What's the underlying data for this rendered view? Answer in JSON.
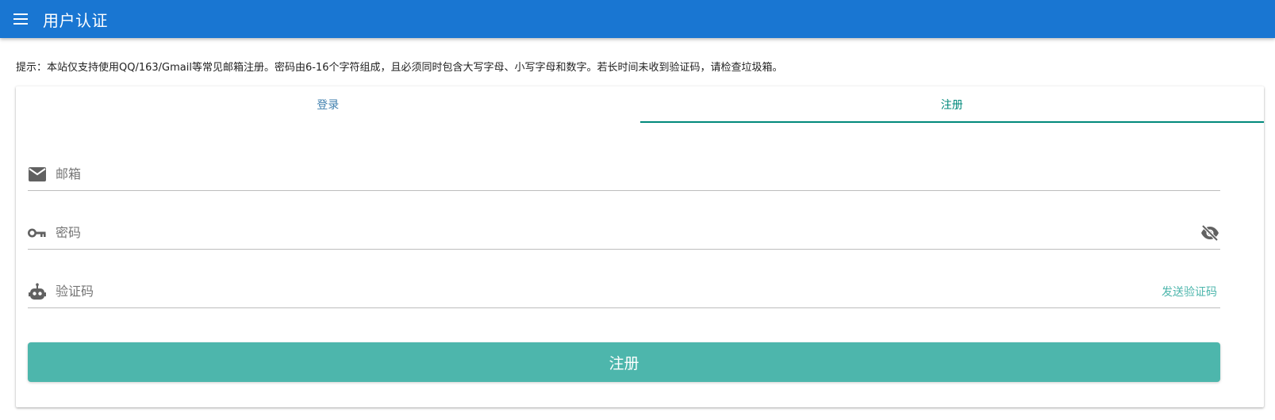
{
  "colors": {
    "primary": "#1976d2",
    "teal": "#00897b",
    "teal_light": "#4db6ac",
    "button": "#4db6ac",
    "icon_gray": "#616161"
  },
  "appbar": {
    "title": "用户认证",
    "menu_icon": "hamburger-menu-icon"
  },
  "notice": "提示：本站仅支持使用QQ/163/Gmail等常见邮箱注册。密码由6-16个字符组成，且必须同时包含大写字母、小写字母和数字。若长时间未收到验证码，请检查垃圾箱。",
  "tabs": [
    {
      "label": "登录",
      "active": false
    },
    {
      "label": "注册",
      "active": true
    }
  ],
  "form": {
    "email": {
      "placeholder": "邮箱",
      "value": "",
      "icon": "mail-icon"
    },
    "password": {
      "placeholder": "密码",
      "value": "",
      "icon": "key-icon",
      "toggle_icon": "eye-off-icon"
    },
    "code": {
      "placeholder": "验证码",
      "value": "",
      "icon": "robot-icon",
      "send_label": "发送验证码"
    },
    "submit_label": "注册"
  }
}
